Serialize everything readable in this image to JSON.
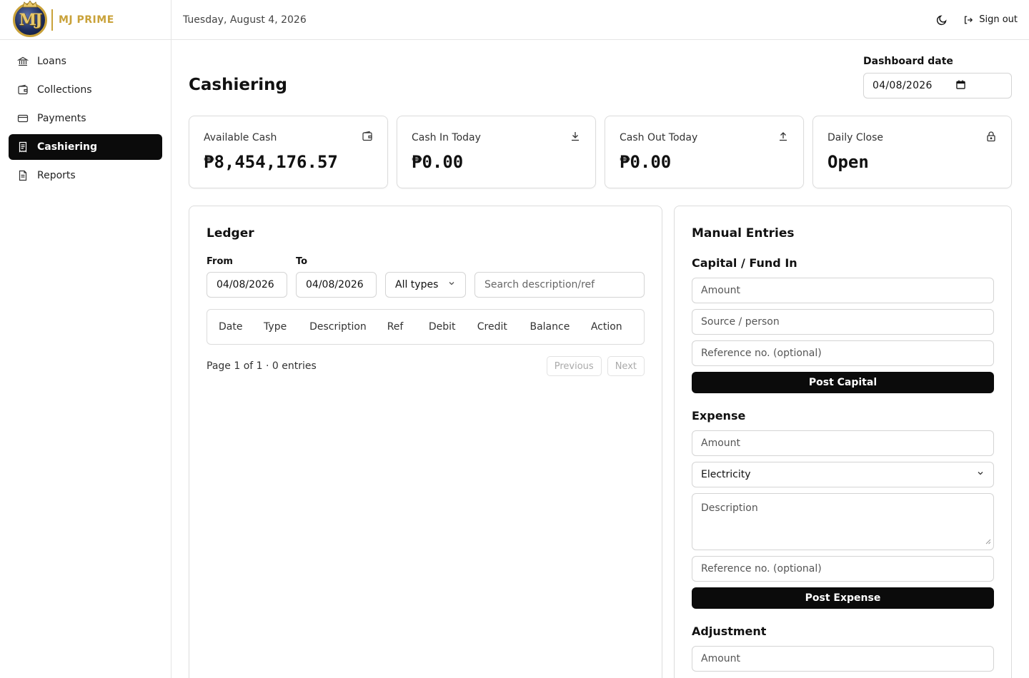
{
  "brand": {
    "name": "MJ PRIME",
    "logo_text": "MJ"
  },
  "header": {
    "date": "Tuesday, August 4, 2026",
    "theme_icon": "moon-icon",
    "signout_label": "Sign out"
  },
  "sidebar": {
    "items": [
      {
        "label": "Loans",
        "icon": "bank-icon",
        "active": false
      },
      {
        "label": "Collections",
        "icon": "wallet-icon",
        "active": false
      },
      {
        "label": "Payments",
        "icon": "credit-card-icon",
        "active": false
      },
      {
        "label": "Cashiering",
        "icon": "receipt-icon",
        "active": true
      },
      {
        "label": "Reports",
        "icon": "file-text-icon",
        "active": false
      }
    ]
  },
  "page": {
    "title": "Cashiering",
    "dashboard_date_label": "Dashboard date",
    "dashboard_date_value": "04/08/2026"
  },
  "cards": [
    {
      "label": "Available Cash",
      "value": "₱8,454,176.57",
      "icon": "wallet-icon"
    },
    {
      "label": "Cash In Today",
      "value": "₱0.00",
      "icon": "download-icon"
    },
    {
      "label": "Cash Out Today",
      "value": "₱0.00",
      "icon": "upload-icon"
    },
    {
      "label": "Daily Close",
      "value": "Open",
      "icon": "lock-icon"
    }
  ],
  "ledger": {
    "title": "Ledger",
    "from_label": "From",
    "from_value": "04/08/2026",
    "to_label": "To",
    "to_value": "04/08/2026",
    "type_filter": "All types",
    "search_placeholder": "Search description/ref",
    "columns": [
      "Date",
      "Type",
      "Description",
      "Ref",
      "Debit",
      "Credit",
      "Balance",
      "Action"
    ],
    "rows": [],
    "pagination_text": "Page 1 of 1 · 0 entries",
    "prev_label": "Previous",
    "next_label": "Next"
  },
  "manual": {
    "title": "Manual Entries",
    "capital": {
      "title": "Capital / Fund In",
      "amount_placeholder": "Amount",
      "source_placeholder": "Source / person",
      "ref_placeholder": "Reference no. (optional)",
      "button": "Post Capital"
    },
    "expense": {
      "title": "Expense",
      "amount_placeholder": "Amount",
      "category_value": "Electricity",
      "description_placeholder": "Description",
      "ref_placeholder": "Reference no. (optional)",
      "button": "Post Expense"
    },
    "adjustment": {
      "title": "Adjustment",
      "amount_placeholder": "Amount"
    }
  }
}
